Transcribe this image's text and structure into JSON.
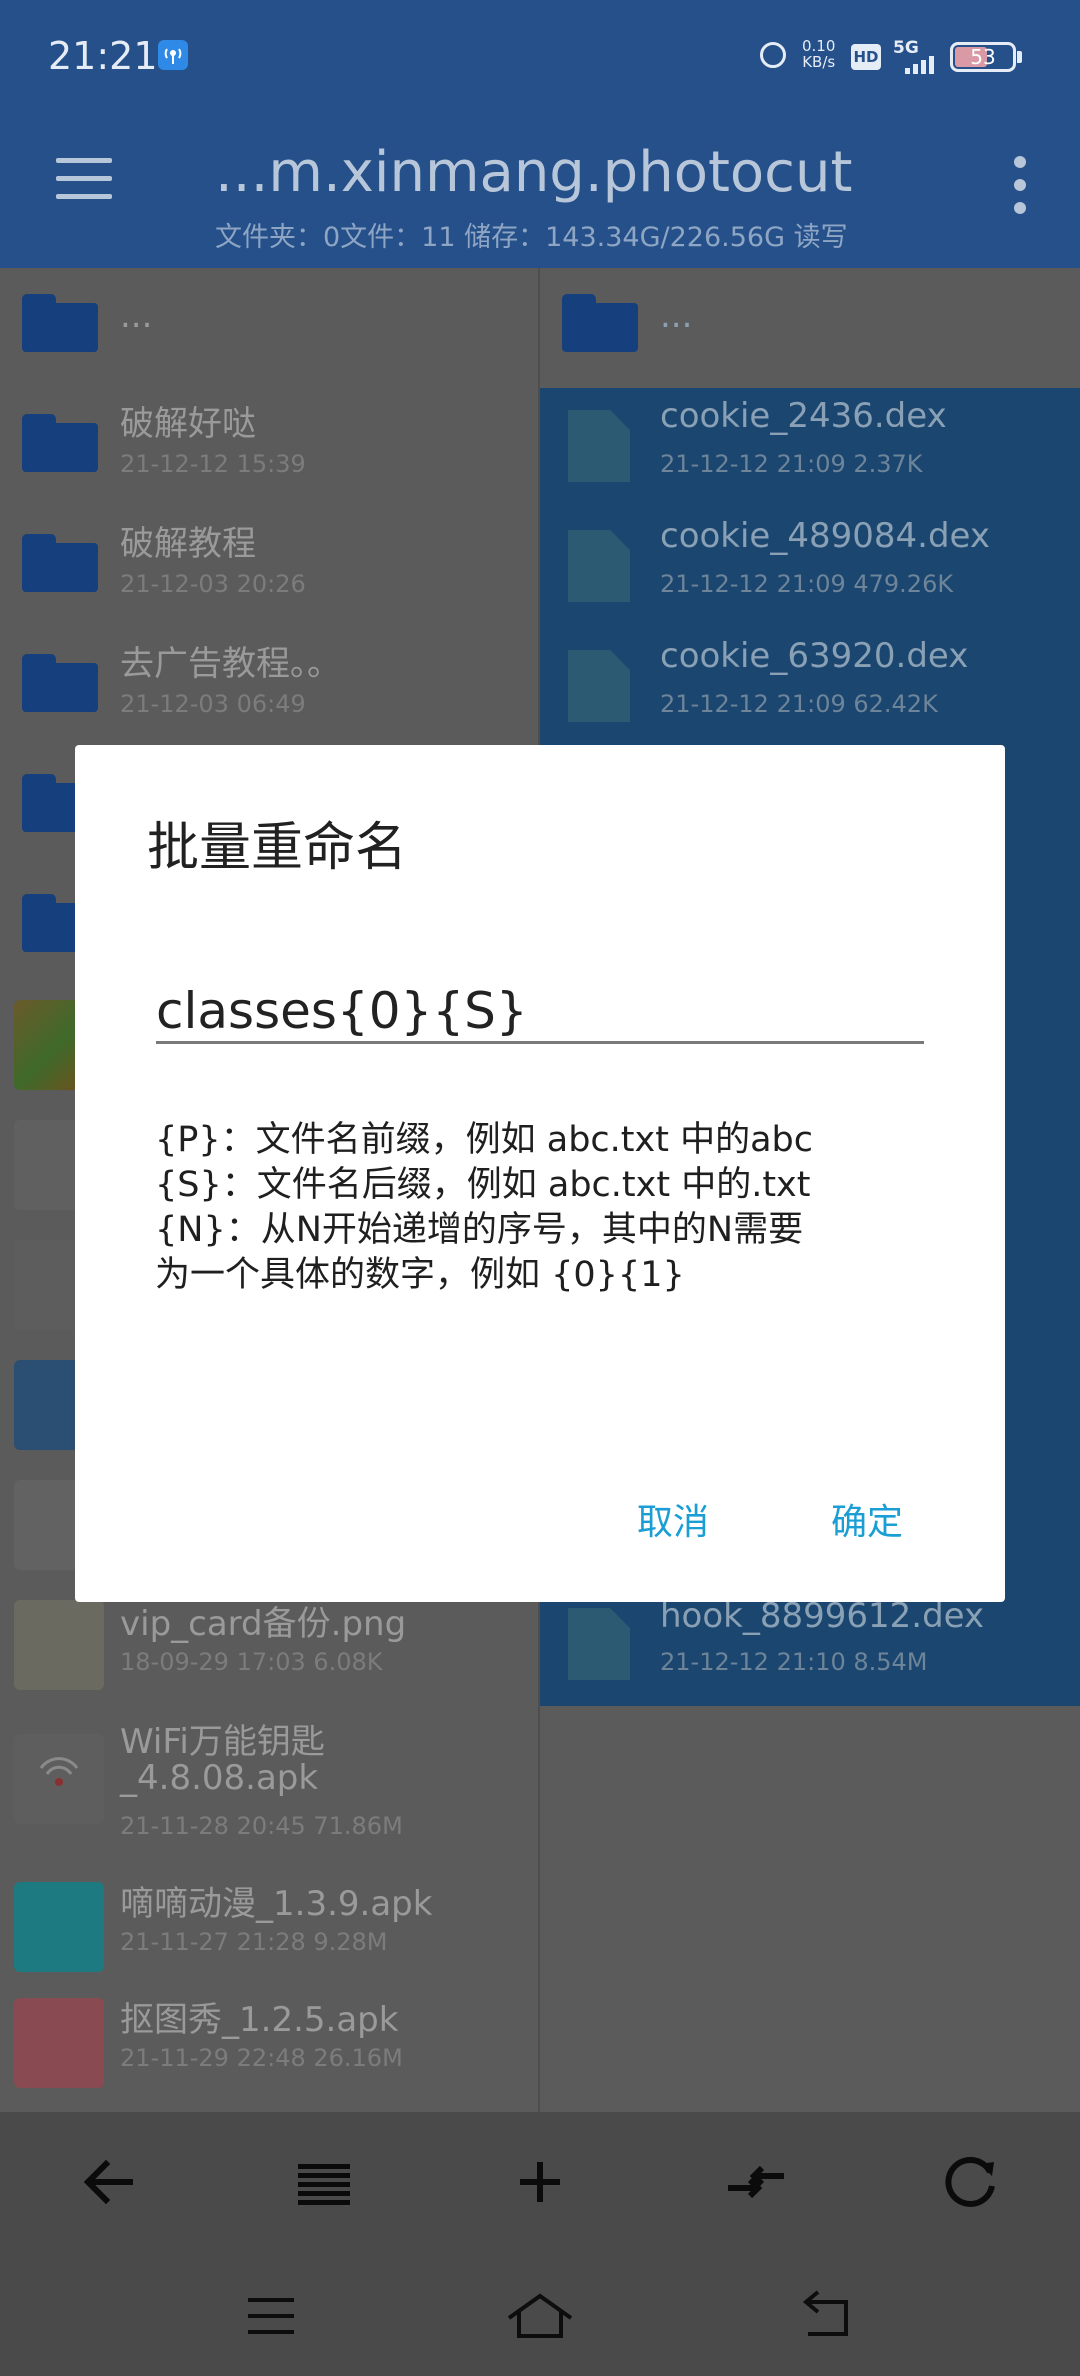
{
  "status_bar": {
    "time": "21:21",
    "net_speed_value": "0.10",
    "net_speed_unit": "KB/s",
    "hd_label": "HD",
    "network_label": "5G",
    "battery_level": "53"
  },
  "header": {
    "title": "...m.xinmang.photocut",
    "storage_info": "文件夹：0文件：11  储存：143.34G/226.56G    读写"
  },
  "left_pane": {
    "parent": {
      "name": "..."
    },
    "items": [
      {
        "name": "破解好哒",
        "meta": "21-12-12 15:39"
      },
      {
        "name": "破解教程",
        "meta": "21-12-03 20:26"
      },
      {
        "name": "去广告教程。。",
        "meta": "21-12-03 06:49"
      },
      {
        "name": "vip_card备份.png",
        "meta": "18-09-29 17:03  6.08K"
      },
      {
        "name": "WiFi万能钥匙",
        "name2": "_4.8.08.apk",
        "meta": "21-11-28 20:45  71.86M"
      },
      {
        "name": "嘀嘀动漫_1.3.9.apk",
        "meta": "21-11-27 21:28  9.28M"
      },
      {
        "name": "抠图秀_1.2.5.apk",
        "meta": "21-11-29 22:48  26.16M"
      }
    ]
  },
  "right_pane": {
    "parent": {
      "name": "..."
    },
    "items": [
      {
        "name": "cookie_2436.dex",
        "meta": "21-12-12 21:09  2.37K"
      },
      {
        "name": "cookie_489084.dex",
        "meta": "21-12-12 21:09  479.26K"
      },
      {
        "name": "cookie_63920.dex",
        "meta": "21-12-12 21:09  62.42K"
      },
      {
        "name": "hook_8899612.dex",
        "meta": "21-12-12 21:10  8.54M"
      }
    ]
  },
  "dialog": {
    "title": "批量重命名",
    "input_value": "classes{0}{S}",
    "help_lines": [
      "{P}：文件名前缀，例如 abc.txt 中的abc",
      " {S}：文件名后缀，例如 abc.txt 中的.txt",
      " {N}：从N开始递增的序号，其中的N需要",
      "为一个具体的数字，例如 {0}{1}"
    ],
    "cancel_label": "取消",
    "confirm_label": "确定"
  },
  "colors": {
    "header_bg": "#25508a",
    "accent": "#1a9ed4",
    "selection_bg": "#1a4670"
  }
}
